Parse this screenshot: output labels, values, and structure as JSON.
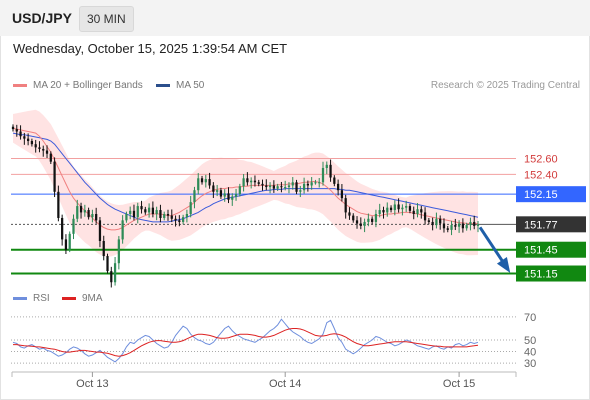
{
  "header": {
    "symbol": "USD/JPY",
    "timeframe": "30 MIN"
  },
  "datetime": "Wednesday, October 15, 2025 1:39:54 AM CET",
  "legend": {
    "ma20": "MA 20 + Bollinger Bands",
    "ma50": "MA 50",
    "credit": "Research © 2025 Trading Central",
    "rsi": "RSI",
    "ma9": "9MA"
  },
  "colors": {
    "up": "#2e8b57",
    "down": "#111111",
    "ma20": "#f08080",
    "ma50": "#3b5bdb",
    "band": "#ffd9d9",
    "support": "#118811",
    "pivot": "#3366ff",
    "resistance": "#f2a0a0",
    "last_price": "#333333",
    "arrow": "#1f5fa8",
    "rsi": "#6f8fdd",
    "rsi_ma": "#dd2222"
  },
  "chart_data": [
    {
      "type": "candlestick",
      "title": "USD/JPY 30 MIN",
      "x_labels": [
        "Oct 13",
        "Oct 14",
        "Oct 15"
      ],
      "ylim": [
        150.98,
        153.4
      ],
      "price_levels": [
        {
          "label": "152.60",
          "value": 152.6,
          "kind": "resistance"
        },
        {
          "label": "152.40",
          "value": 152.4,
          "kind": "resistance"
        },
        {
          "label": "152.15",
          "value": 152.15,
          "kind": "pivot"
        },
        {
          "label": "151.77",
          "value": 151.77,
          "kind": "last"
        },
        {
          "label": "151.45",
          "value": 151.45,
          "kind": "support"
        },
        {
          "label": "151.15",
          "value": 151.15,
          "kind": "support"
        }
      ],
      "forecast_arrow": {
        "from": 151.77,
        "to": 151.15
      },
      "close_series": [
        152.97,
        152.94,
        152.88,
        152.85,
        152.82,
        152.78,
        152.74,
        152.72,
        152.7,
        152.66,
        152.56,
        152.18,
        151.85,
        151.58,
        151.45,
        151.65,
        151.84,
        152.0,
        151.92,
        151.95,
        151.86,
        151.9,
        151.82,
        151.56,
        151.37,
        151.18,
        151.04,
        151.28,
        151.58,
        151.82,
        151.9,
        151.94,
        151.86,
        152.0,
        151.96,
        151.92,
        151.98,
        151.9,
        151.95,
        151.85,
        151.9,
        151.88,
        151.84,
        151.82,
        151.8,
        151.86,
        151.9,
        152.05,
        152.2,
        152.35,
        152.3,
        152.34,
        152.26,
        152.18,
        152.2,
        152.12,
        152.16,
        152.08,
        152.12,
        152.15,
        152.25,
        152.35,
        152.3,
        152.32,
        152.3,
        152.28,
        152.26,
        152.24,
        152.26,
        152.22,
        152.25,
        152.24,
        152.24,
        152.26,
        152.3,
        152.18,
        152.2,
        152.28,
        152.26,
        152.3,
        152.3,
        152.3,
        152.48,
        152.52,
        152.36,
        152.28,
        152.2,
        152.1,
        151.92,
        151.88,
        151.82,
        151.78,
        151.75,
        151.8,
        151.84,
        151.8,
        151.9,
        151.95,
        151.92,
        151.98,
        151.95,
        152.02,
        151.96,
        151.98,
        152.0,
        151.94,
        151.9,
        151.96,
        151.92,
        151.82,
        151.8,
        151.76,
        151.84,
        151.78,
        151.72,
        151.7,
        151.76,
        151.74,
        151.78,
        151.72,
        151.76,
        151.8,
        151.75,
        151.77
      ],
      "ma20": [
        152.98,
        152.97,
        152.96,
        152.95,
        152.94,
        152.93,
        152.92,
        152.88,
        152.82,
        152.75,
        152.68,
        152.58,
        152.48,
        152.38,
        152.28,
        152.18,
        152.1,
        152.04,
        151.99,
        151.94,
        151.9,
        151.85,
        151.8,
        151.76,
        151.73,
        151.71,
        151.7,
        151.7,
        151.71,
        151.73,
        151.76,
        151.79,
        151.82,
        151.84,
        151.86,
        151.88,
        151.9,
        151.9,
        151.9,
        151.9,
        151.89,
        151.88,
        151.88,
        151.9,
        151.92,
        151.95,
        151.98,
        152.01,
        152.05,
        152.09,
        152.13,
        152.16,
        152.18,
        152.2,
        152.21,
        152.22,
        152.22,
        152.23,
        152.23,
        152.24,
        152.24,
        152.25,
        152.25,
        152.26,
        152.26,
        152.26,
        152.26,
        152.26,
        152.26,
        152.26,
        152.27,
        152.27,
        152.27,
        152.28,
        152.28,
        152.28,
        152.29,
        152.3,
        152.3,
        152.31,
        152.31,
        152.3,
        152.28,
        152.24,
        152.2,
        152.15,
        152.1,
        152.06,
        152.02,
        151.99,
        151.96,
        151.93,
        151.91,
        151.9,
        151.89,
        151.88,
        151.88,
        151.88,
        151.89,
        151.9,
        151.9,
        151.91,
        151.91,
        151.92,
        151.92,
        151.92,
        151.91,
        151.9,
        151.89,
        151.88,
        151.87,
        151.86,
        151.85,
        151.84,
        151.83,
        151.82,
        151.81,
        151.8,
        151.79,
        151.79,
        151.78,
        151.78,
        151.78,
        151.78
      ],
      "ma50": [
        152.92,
        152.91,
        152.9,
        152.9,
        152.89,
        152.88,
        152.87,
        152.86,
        152.85,
        152.84,
        152.82,
        152.78,
        152.72,
        152.66,
        152.6,
        152.54,
        152.48,
        152.42,
        152.36,
        152.3,
        152.25,
        152.2,
        152.15,
        152.1,
        152.06,
        152.02,
        151.99,
        151.96,
        151.94,
        151.92,
        151.9,
        151.88,
        151.86,
        151.84,
        151.83,
        151.82,
        151.81,
        151.8,
        151.8,
        151.8,
        151.8,
        151.8,
        151.81,
        151.82,
        151.83,
        151.84,
        151.86,
        151.88,
        151.9,
        151.92,
        151.95,
        151.98,
        152.0,
        152.03,
        152.05,
        152.07,
        152.09,
        152.1,
        152.11,
        152.12,
        152.13,
        152.14,
        152.15,
        152.16,
        152.17,
        152.18,
        152.19,
        152.2,
        152.2,
        152.21,
        152.21,
        152.21,
        152.22,
        152.22,
        152.22,
        152.22,
        152.22,
        152.22,
        152.22,
        152.22,
        152.22,
        152.22,
        152.22,
        152.22,
        152.22,
        152.22,
        152.21,
        152.21,
        152.2,
        152.2,
        152.19,
        152.18,
        152.17,
        152.16,
        152.15,
        152.14,
        152.13,
        152.12,
        152.11,
        152.1,
        152.09,
        152.08,
        152.07,
        152.06,
        152.05,
        152.04,
        152.03,
        152.02,
        152.01,
        152.0,
        151.99,
        151.98,
        151.97,
        151.96,
        151.95,
        151.94,
        151.93,
        151.92,
        151.91,
        151.9,
        151.89,
        151.88,
        151.87,
        151.86
      ]
    },
    {
      "type": "line",
      "title": "RSI",
      "ylim": [
        24,
        76
      ],
      "y_ticks": [
        30,
        40,
        50,
        70
      ],
      "series": [
        {
          "name": "RSI",
          "values": [
            48,
            47,
            44,
            43,
            45,
            46,
            44,
            42,
            43,
            41,
            40,
            38,
            36,
            37,
            39,
            42,
            44,
            43,
            41,
            38,
            36,
            37,
            39,
            41,
            38,
            35,
            33,
            31,
            34,
            38,
            44,
            48,
            47,
            50,
            52,
            54,
            53,
            50,
            47,
            45,
            43,
            44,
            48,
            54,
            58,
            62,
            60,
            55,
            52,
            50,
            49,
            47,
            46,
            48,
            52,
            56,
            60,
            62,
            58,
            55,
            53,
            51,
            50,
            49,
            48,
            50,
            52,
            55,
            58,
            60,
            63,
            68,
            64,
            60,
            57,
            55,
            53,
            50,
            48,
            47,
            49,
            51,
            55,
            65,
            67,
            60,
            52,
            48,
            42,
            40,
            38,
            40,
            43,
            46,
            48,
            50,
            53,
            52,
            50,
            48,
            47,
            45,
            46,
            48,
            50,
            49,
            47,
            45,
            44,
            43,
            42,
            44,
            45,
            43,
            42,
            44,
            43,
            46,
            47,
            45,
            46,
            48,
            47,
            48
          ]
        },
        {
          "name": "9MA",
          "values": [
            46,
            46,
            45.5,
            45,
            44.8,
            44.5,
            44.2,
            44,
            43.5,
            43,
            42.5,
            42,
            41,
            40,
            39.5,
            39.5,
            40,
            40.5,
            41,
            41,
            40.5,
            40,
            39.5,
            39.5,
            39,
            38.5,
            37.5,
            36.5,
            36,
            36.5,
            37.5,
            39,
            41,
            43,
            45,
            46.5,
            48,
            49,
            49.5,
            49.5,
            49,
            48.5,
            48,
            48,
            48.5,
            49.5,
            51,
            52.5,
            54,
            55,
            55,
            54.5,
            54,
            53,
            52,
            51.5,
            51.5,
            52,
            53,
            54,
            55,
            55,
            55,
            54.5,
            54,
            53,
            52.5,
            52.5,
            53,
            54,
            55.5,
            57,
            58.5,
            59.5,
            60,
            60,
            59.5,
            58.5,
            57,
            55.5,
            54,
            53.5,
            53.5,
            54,
            55,
            55.5,
            55,
            54,
            52.5,
            50.5,
            48.5,
            47,
            46,
            45,
            45,
            45.5,
            46,
            46.5,
            47,
            47.5,
            48,
            48.5,
            48.5,
            48.5,
            48.5,
            48,
            47.5,
            47,
            46.5,
            46,
            45.5,
            45,
            44.5,
            44.5,
            44,
            44,
            44,
            44,
            44,
            44,
            44,
            44.5,
            45,
            45.5
          ]
        }
      ]
    }
  ]
}
